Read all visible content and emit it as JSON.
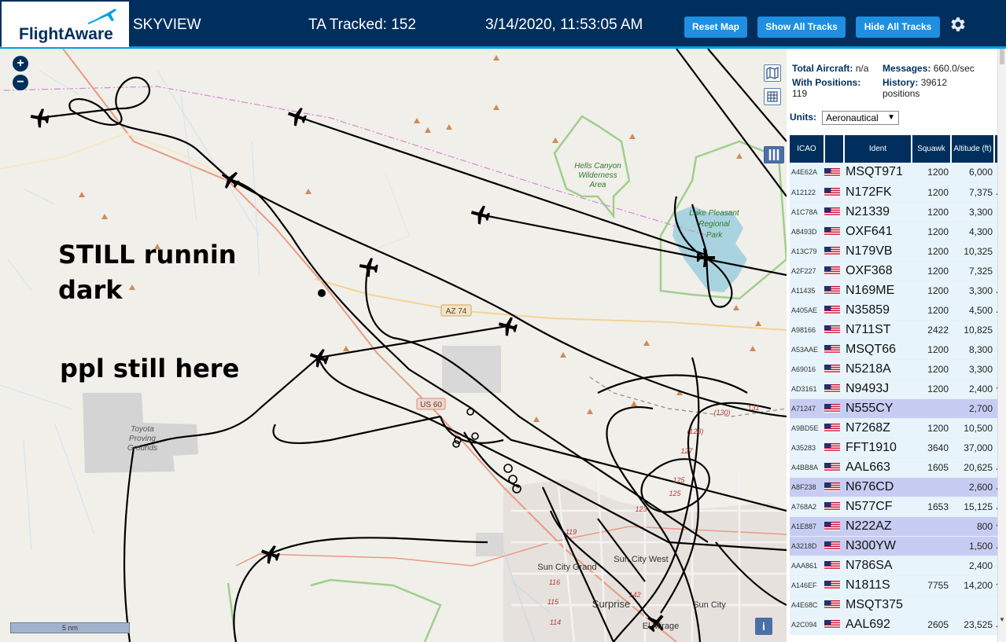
{
  "header": {
    "logo_text": "FlightAware",
    "app_name": "SKYVIEW",
    "tracked": "TA Tracked: 152",
    "datetime": "3/14/2020, 11:53:05 AM",
    "reset_map": "Reset Map",
    "show_all_tracks": "Show All Tracks",
    "hide_all_tracks": "Hide All Tracks",
    "settings_icon": "gear-icon"
  },
  "map": {
    "zoom_in": "+",
    "zoom_out": "−",
    "scale_label": "5 nm",
    "info_button": "i",
    "labels": {
      "hells_canyon": [
        "Hells Canyon",
        "Wilderness",
        "Area"
      ],
      "lake_pleasant": [
        "Lake Pleasant",
        "Regional",
        "Park"
      ],
      "toyota": [
        "Toyota",
        "Proving",
        "Grounds"
      ],
      "az74": "AZ 74",
      "us60": "US 60",
      "sun_city_grand": "Sun City Grand",
      "sun_city_west": "Sun City West",
      "surprise": "Surprise",
      "sun_city": "Sun City",
      "el_mirage": "El Mirage",
      "route_numbers": [
        "(130)",
        "(128)",
        "127",
        "125",
        "123",
        "119",
        "116",
        "115",
        "114",
        "142",
        "131",
        "125"
      ]
    },
    "annotation_1": [
      "STILL runnin",
      "dark"
    ],
    "annotation_2": "ppl still here"
  },
  "panel": {
    "total_aircraft_label": "Total Aircraft:",
    "total_aircraft_value": "n/a",
    "messages_label": "Messages:",
    "messages_value": "660.0/sec",
    "with_positions_label": "With Positions:",
    "with_positions_value": "119",
    "history_label": "History:",
    "history_value": "39612",
    "history_unit": "positions",
    "units_label": "Units:",
    "units_value": "Aeronautical",
    "columns": [
      "ICAO",
      "",
      "Ident",
      "Squawk",
      "Altitude (ft)",
      ""
    ],
    "rows": [
      {
        "icao": "A4E62A",
        "ident": "MSQT971",
        "squawk": "1200",
        "alt": "6,000",
        "trend": "",
        "sel": false
      },
      {
        "icao": "A12122",
        "ident": "N172FK",
        "squawk": "1200",
        "alt": "7,375",
        "trend": "▲",
        "sel": false
      },
      {
        "icao": "A1C78A",
        "ident": "N21339",
        "squawk": "1200",
        "alt": "3,300",
        "trend": "",
        "sel": false
      },
      {
        "icao": "A8493D",
        "ident": "OXF641",
        "squawk": "1200",
        "alt": "4,300",
        "trend": "",
        "sel": false
      },
      {
        "icao": "A13C79",
        "ident": "N179VB",
        "squawk": "1200",
        "alt": "10,325",
        "trend": "",
        "sel": false
      },
      {
        "icao": "A2F227",
        "ident": "OXF368",
        "squawk": "1200",
        "alt": "7,325",
        "trend": "",
        "sel": false
      },
      {
        "icao": "A11435",
        "ident": "N169ME",
        "squawk": "1200",
        "alt": "3,300",
        "trend": "▲",
        "sel": false
      },
      {
        "icao": "A405AE",
        "ident": "N35859",
        "squawk": "1200",
        "alt": "4,500",
        "trend": "▲",
        "sel": false
      },
      {
        "icao": "A98166",
        "ident": "N711ST",
        "squawk": "2422",
        "alt": "10,825",
        "trend": "",
        "sel": false
      },
      {
        "icao": "A53AAE",
        "ident": "MSQT66",
        "squawk": "1200",
        "alt": "8,300",
        "trend": "",
        "sel": false
      },
      {
        "icao": "A69016",
        "ident": "N5218A",
        "squawk": "1200",
        "alt": "3,300",
        "trend": "",
        "sel": false
      },
      {
        "icao": "AD3161",
        "ident": "N9493J",
        "squawk": "1200",
        "alt": "2,400",
        "trend": "▼",
        "sel": false
      },
      {
        "icao": "A71247",
        "ident": "N555CY",
        "squawk": "",
        "alt": "2,700",
        "trend": "",
        "sel": true
      },
      {
        "icao": "A9BD5E",
        "ident": "N7268Z",
        "squawk": "1200",
        "alt": "10,500",
        "trend": "",
        "sel": false
      },
      {
        "icao": "A35283",
        "ident": "FFT1910",
        "squawk": "3640",
        "alt": "37,000",
        "trend": "",
        "sel": false
      },
      {
        "icao": "A4BB8A",
        "ident": "AAL663",
        "squawk": "1605",
        "alt": "20,625",
        "trend": "▲",
        "sel": false
      },
      {
        "icao": "A8F238",
        "ident": "N676CD",
        "squawk": "",
        "alt": "2,600",
        "trend": "▲",
        "sel": true
      },
      {
        "icao": "A768A2",
        "ident": "N577CF",
        "squawk": "1653",
        "alt": "15,125",
        "trend": "▲",
        "sel": false
      },
      {
        "icao": "A1E887",
        "ident": "N222AZ",
        "squawk": "",
        "alt": "800",
        "trend": "▼",
        "sel": true
      },
      {
        "icao": "A3218D",
        "ident": "N300YW",
        "squawk": "",
        "alt": "1,500",
        "trend": "▲",
        "sel": true
      },
      {
        "icao": "AAA861",
        "ident": "N786SA",
        "squawk": "",
        "alt": "2,400",
        "trend": "",
        "sel": false
      },
      {
        "icao": "A146EF",
        "ident": "N1811S",
        "squawk": "7755",
        "alt": "14,200",
        "trend": "▼",
        "sel": false
      },
      {
        "icao": "A4E68C",
        "ident": "MSQT375",
        "squawk": "",
        "alt": "",
        "trend": "",
        "sel": false
      },
      {
        "icao": "A2C094",
        "ident": "AAL692",
        "squawk": "2605",
        "alt": "23,525",
        "trend": "▲",
        "sel": false
      }
    ]
  }
}
